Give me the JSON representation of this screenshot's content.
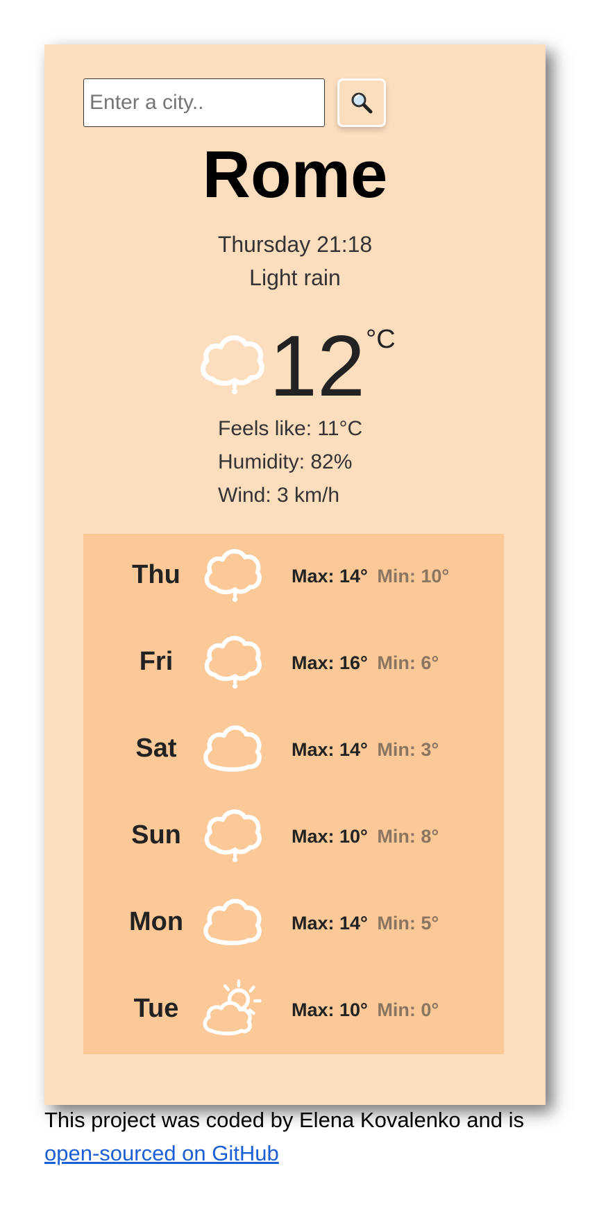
{
  "search": {
    "placeholder": "Enter a city..",
    "button_icon": "magnifier-icon"
  },
  "current": {
    "city": "Rome",
    "datetime": "Thursday 21:18",
    "description": "Light rain",
    "temperature": "12",
    "unit": "°C",
    "icon": "rain-cloud-icon",
    "feels_like": "Feels like: 11°C",
    "humidity": "Humidity: 82%",
    "wind": "Wind: 3 km/h"
  },
  "forecast": [
    {
      "day": "Thu",
      "icon": "rain-cloud-icon",
      "max": "Max: 14°",
      "min": "Min: 10°"
    },
    {
      "day": "Fri",
      "icon": "rain-cloud-icon",
      "max": "Max: 16°",
      "min": "Min: 6°"
    },
    {
      "day": "Sat",
      "icon": "cloud-icon",
      "max": "Max: 14°",
      "min": "Min: 3°"
    },
    {
      "day": "Sun",
      "icon": "rain-cloud-icon",
      "max": "Max: 10°",
      "min": "Min: 8°"
    },
    {
      "day": "Mon",
      "icon": "cloud-icon",
      "max": "Max: 14°",
      "min": "Min: 5°"
    },
    {
      "day": "Tue",
      "icon": "partly-sunny-icon",
      "max": "Max: 10°",
      "min": "Min: 0°"
    }
  ],
  "footer": {
    "text": "This project was coded by Elena Kovalenko and is",
    "link_text": "open-sourced on GitHub"
  },
  "colors": {
    "card_background": "#fcdebf",
    "forecast_background": "#fbc998",
    "min_temp": "#8c7560",
    "link": "#1a5fd6"
  }
}
